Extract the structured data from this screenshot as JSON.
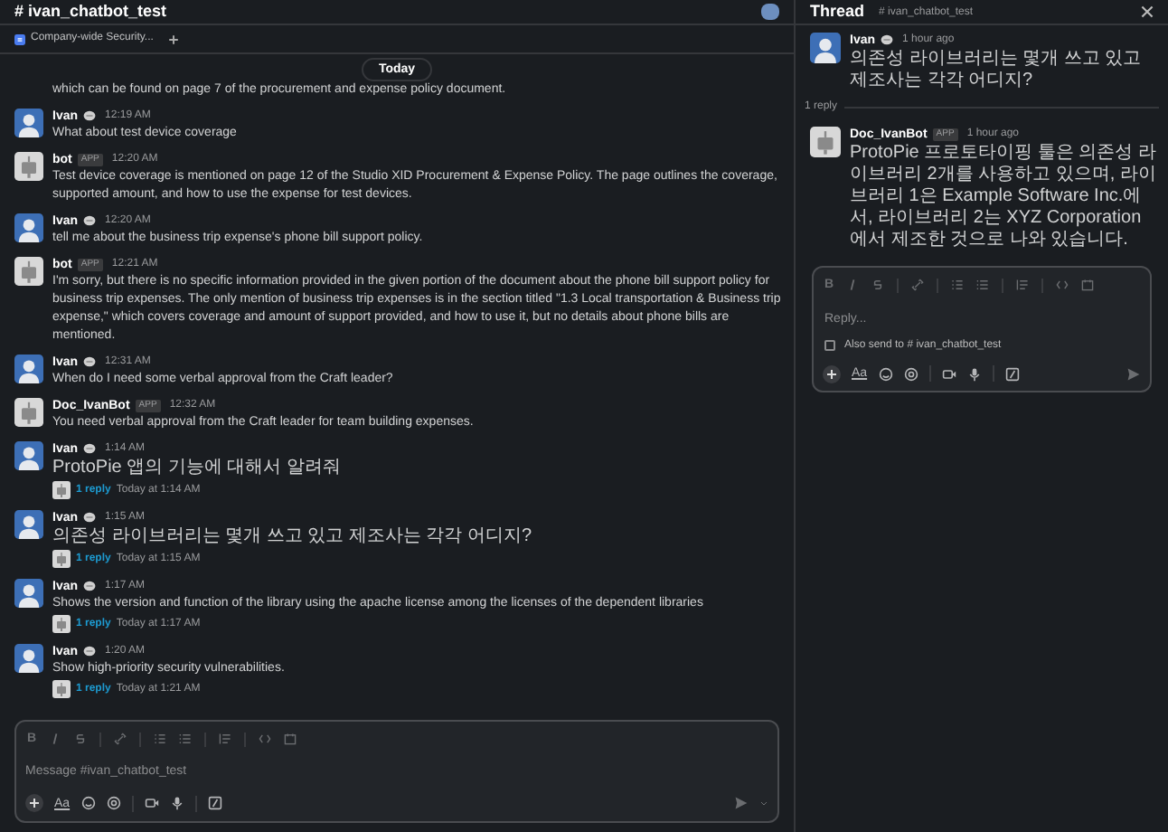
{
  "channel": {
    "title": "# ivan_chatbot_test"
  },
  "bookmarks": [
    {
      "label": "Company-wide Security..."
    }
  ],
  "date_divider": "Today",
  "messages": [
    {
      "kind": "continuation",
      "text": "which can be found on page 7 of the procurement and expense policy document."
    },
    {
      "kind": "user",
      "author": "Ivan",
      "time": "12:19 AM",
      "text": "What about test device coverage"
    },
    {
      "kind": "bot",
      "author": "bot",
      "badge": "APP",
      "time": "12:20 AM",
      "text": "Test device coverage is mentioned on page 12 of the Studio XID Procurement & Expense Policy. The page outlines the coverage, supported amount, and how to use the expense for test devices."
    },
    {
      "kind": "user",
      "author": "Ivan",
      "time": "12:20 AM",
      "text": "tell me about the business trip expense's phone bill support policy."
    },
    {
      "kind": "bot",
      "author": "bot",
      "badge": "APP",
      "time": "12:21 AM",
      "text": "I'm sorry, but there is no specific information provided in the given portion of the document about the phone bill support policy for business trip expenses. The only mention of business trip expenses is in the section titled \"1.3 Local transportation & Business trip expense,\" which covers coverage and amount of support provided, and how to use it, but no details about phone bills are mentioned."
    },
    {
      "kind": "user",
      "author": "Ivan",
      "time": "12:31 AM",
      "text": "When do I need some verbal approval from the Craft leader?"
    },
    {
      "kind": "bot",
      "author": "Doc_IvanBot",
      "badge": "APP",
      "time": "12:32 AM",
      "text": "You need verbal approval from the Craft leader for team building expenses."
    },
    {
      "kind": "user",
      "author": "Ivan",
      "time": "1:14 AM",
      "text": "ProtoPie 앱의 기능에 대해서 알려줘",
      "replies": {
        "count": "1 reply",
        "time": "Today at 1:14 AM"
      }
    },
    {
      "kind": "user",
      "author": "Ivan",
      "time": "1:15 AM",
      "text": "의존성 라이브러리는 몇개 쓰고 있고 제조사는 각각 어디지?",
      "replies": {
        "count": "1 reply",
        "time": "Today at 1:15 AM"
      }
    },
    {
      "kind": "user",
      "author": "Ivan",
      "time": "1:17 AM",
      "text": "Shows the version and function of the library using the apache license among the licenses of the dependent libraries",
      "replies": {
        "count": "1 reply",
        "time": "Today at 1:17 AM"
      }
    },
    {
      "kind": "user",
      "author": "Ivan",
      "time": "1:20 AM",
      "text": "Show high-priority security vulnerabilities.",
      "replies": {
        "count": "1 reply",
        "time": "Today at 1:21 AM"
      }
    }
  ],
  "composer": {
    "placeholder": "Message #ivan_chatbot_test",
    "bold_glyph": "B",
    "format_glyph": "Aa"
  },
  "thread": {
    "title": "Thread",
    "channel": "# ivan_chatbot_test",
    "parent": {
      "kind": "user",
      "author": "Ivan",
      "time": "1 hour ago",
      "text": "의존성 라이브러리는 몇개 쓰고 있고 제조사는 각각 어디지?"
    },
    "reply_count": "1 reply",
    "replies": [
      {
        "kind": "bot",
        "author": "Doc_IvanBot",
        "badge": "APP",
        "time": "1 hour ago",
        "text": "ProtoPie 프로토타이핑 툴은 의존성 라이브러리 2개를 사용하고 있으며, 라이브러리 1은 Example Software Inc.에서, 라이브러리 2는 XYZ Corporation에서 제조한 것으로 나와 있습니다."
      }
    ],
    "composer": {
      "placeholder": "Reply...",
      "bold_glyph": "B",
      "format_glyph": "Aa",
      "also_send": {
        "label": "Also send to # ivan_chatbot_test",
        "checked": false
      }
    }
  }
}
